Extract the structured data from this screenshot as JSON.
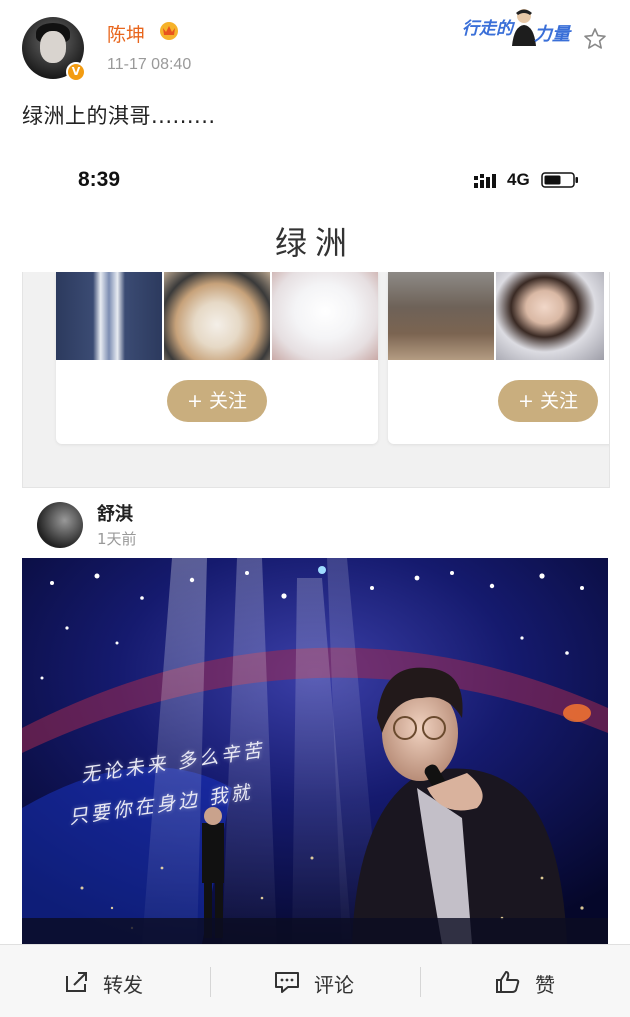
{
  "post": {
    "author": "陈坤",
    "time": "11-17 08:40",
    "text": "绿洲上的淇哥.........",
    "topic_badge": {
      "part1": "行走的",
      "part2": "力量"
    }
  },
  "embedded": {
    "status_time": "8:39",
    "network": "4G",
    "app_title": "绿洲",
    "follow_label": "+ 关注",
    "poster_name": "舒淇",
    "poster_time": "1天前",
    "lyrics": [
      "无论未来 多么辛苦",
      "只要你在身边 我就"
    ]
  },
  "actions": {
    "repost": "转发",
    "comment": "评论",
    "like": "赞"
  },
  "colors": {
    "author": "#e8661d",
    "follow_button": "#c9ae7e",
    "topic": "#3a6fd8"
  }
}
